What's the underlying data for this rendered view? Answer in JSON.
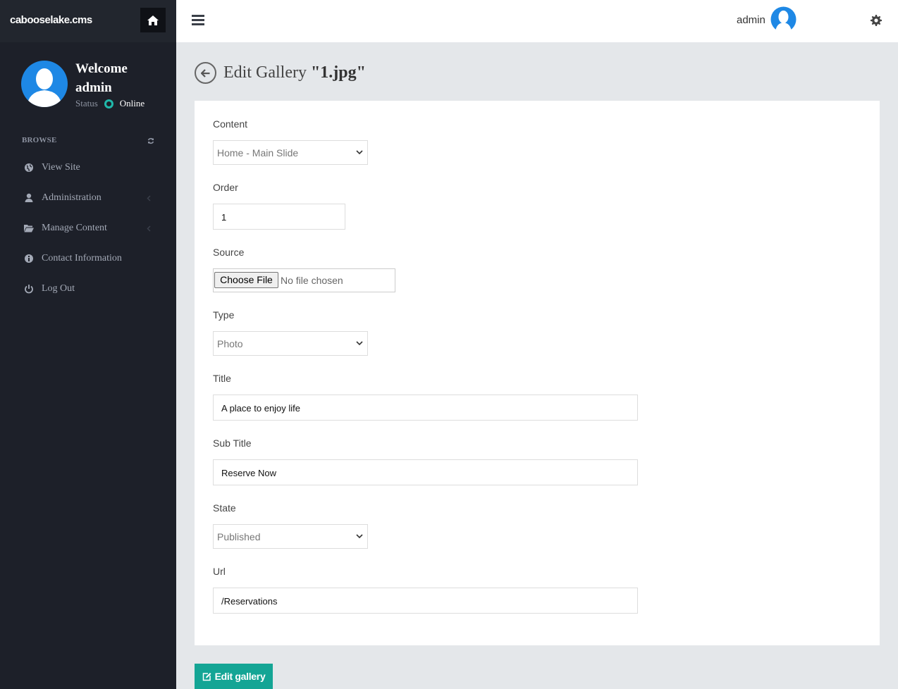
{
  "brand": {
    "name": "cabooselake.cms"
  },
  "user_panel": {
    "welcome": "Welcome admin",
    "status_label": "Status",
    "status_value": "Online"
  },
  "sidebar": {
    "section_title": "BROWSE",
    "items": [
      {
        "label": "View Site",
        "icon": "globe-icon"
      },
      {
        "label": "Administration",
        "icon": "user-icon",
        "has_submenu": true
      },
      {
        "label": "Manage Content",
        "icon": "folder-open-icon",
        "has_submenu": true
      },
      {
        "label": "Contact Information",
        "icon": "info-icon"
      },
      {
        "label": "Log Out",
        "icon": "power-icon"
      }
    ]
  },
  "header": {
    "username": "admin"
  },
  "page": {
    "title_prefix": "Edit Gallery ",
    "title_name": "\"1.jpg\""
  },
  "form": {
    "content": {
      "label": "Content",
      "value": "Home - Main Slide"
    },
    "order": {
      "label": "Order",
      "value": "1"
    },
    "source": {
      "label": "Source",
      "button": "Choose File",
      "status": "No file chosen"
    },
    "type": {
      "label": "Type",
      "value": "Photo"
    },
    "title": {
      "label": "Title",
      "value": "A place to enjoy life"
    },
    "subtitle": {
      "label": "Sub Title",
      "value": "Reserve Now"
    },
    "state": {
      "label": "State",
      "value": "Published"
    },
    "url": {
      "label": "Url",
      "value": "/Reservations"
    }
  },
  "actions": {
    "submit": "Edit gallery"
  },
  "colors": {
    "sidebar": "#1d2029",
    "accent": "#14a595",
    "avatar": "#1e88e5",
    "online": "#20b8aa"
  }
}
